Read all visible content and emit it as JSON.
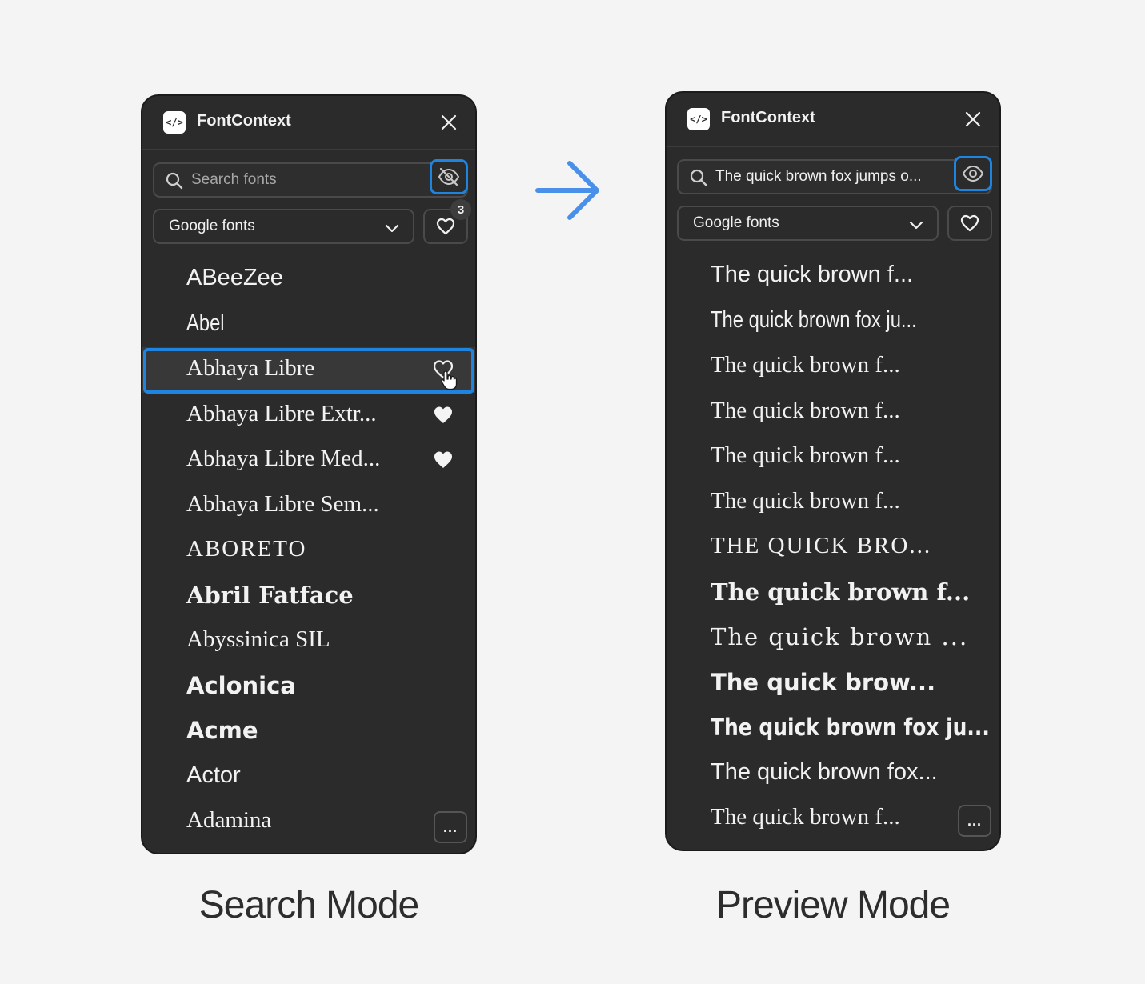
{
  "search_mode": {
    "app_title": "FontContext",
    "search": {
      "placeholder": "Search fonts",
      "value": ""
    },
    "source": "Google fonts",
    "favorites_count": "3",
    "fonts": [
      "ABeeZee",
      "Abel",
      "Abhaya Libre",
      "Abhaya Libre Extr...",
      "Abhaya Libre Med...",
      "Abhaya Libre Sem...",
      "ABORETO",
      "Abril Fatface",
      "Abyssinica SIL",
      "Aclonica",
      "Acme",
      "Actor",
      "Adamina"
    ],
    "more_label": "..."
  },
  "preview_mode": {
    "app_title": "FontContext",
    "search": {
      "value": "The quick brown fox jumps o..."
    },
    "source": "Google fonts",
    "previews": [
      "The quick brown f...",
      "The quick brown fox ju...",
      "The quick brown f...",
      "The quick brown f...",
      "The quick brown f...",
      "The quick brown f...",
      "THE QUICK BRO...",
      "The quick brown f...",
      "The quick brown ...",
      "The quick brow...",
      "The quick brown fox ju...",
      "The quick brown fox...",
      "The quick brown f..."
    ],
    "more_label": "..."
  },
  "captions": {
    "left": "Search Mode",
    "right": "Preview Mode"
  },
  "colors": {
    "accent": "#1f84e0",
    "arrow": "#4a8fe8",
    "panel_bg": "#2b2b2b",
    "page_bg": "#f4f4f4"
  }
}
